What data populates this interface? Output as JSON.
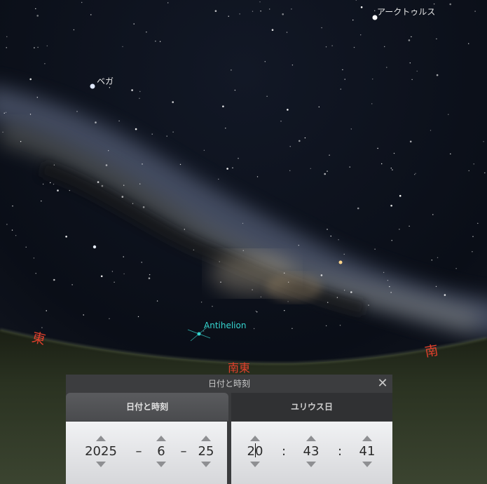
{
  "sky": {
    "star_labels": [
      "アークトゥルス",
      "ベガ",
      "Antihelion"
    ],
    "compass": [
      "東",
      "南東",
      "南"
    ]
  },
  "dialog": {
    "title": "日付と時刻",
    "tabs": [
      "日付と時刻",
      "ユリウス日"
    ],
    "date": {
      "year": "2025",
      "month": "6",
      "day": "25",
      "separator": "–"
    },
    "time": {
      "hour": "20",
      "minute": "43",
      "second": "41",
      "separator": ":"
    }
  },
  "colors": {
    "compass": "#e0402c",
    "antihelion": "#35d6d0",
    "panel": "#e6e7ea"
  }
}
